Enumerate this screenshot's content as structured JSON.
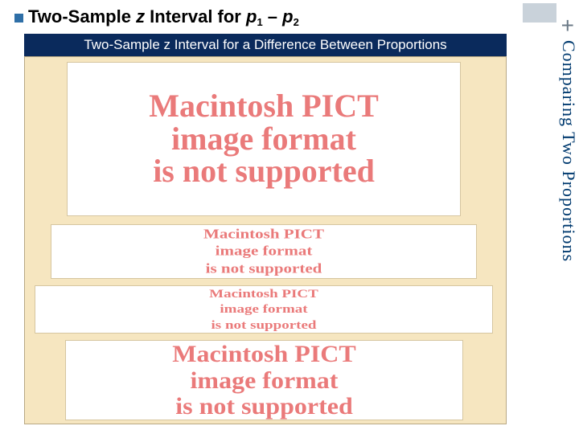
{
  "heading": {
    "prefix": "Two-Sample ",
    "z": "z",
    "middle": " Interval for ",
    "p": "p",
    "sub1": "1",
    "dash": " – ",
    "p2": "p",
    "sub2": "2"
  },
  "band_title": "Two-Sample z Interval for a Difference Between Proportions",
  "side_title": "Comparing Two Proportions",
  "plus_symbol": "+",
  "pict_error": {
    "line1": "Macintosh PICT",
    "line2": "image format",
    "line3": "is not supported"
  }
}
